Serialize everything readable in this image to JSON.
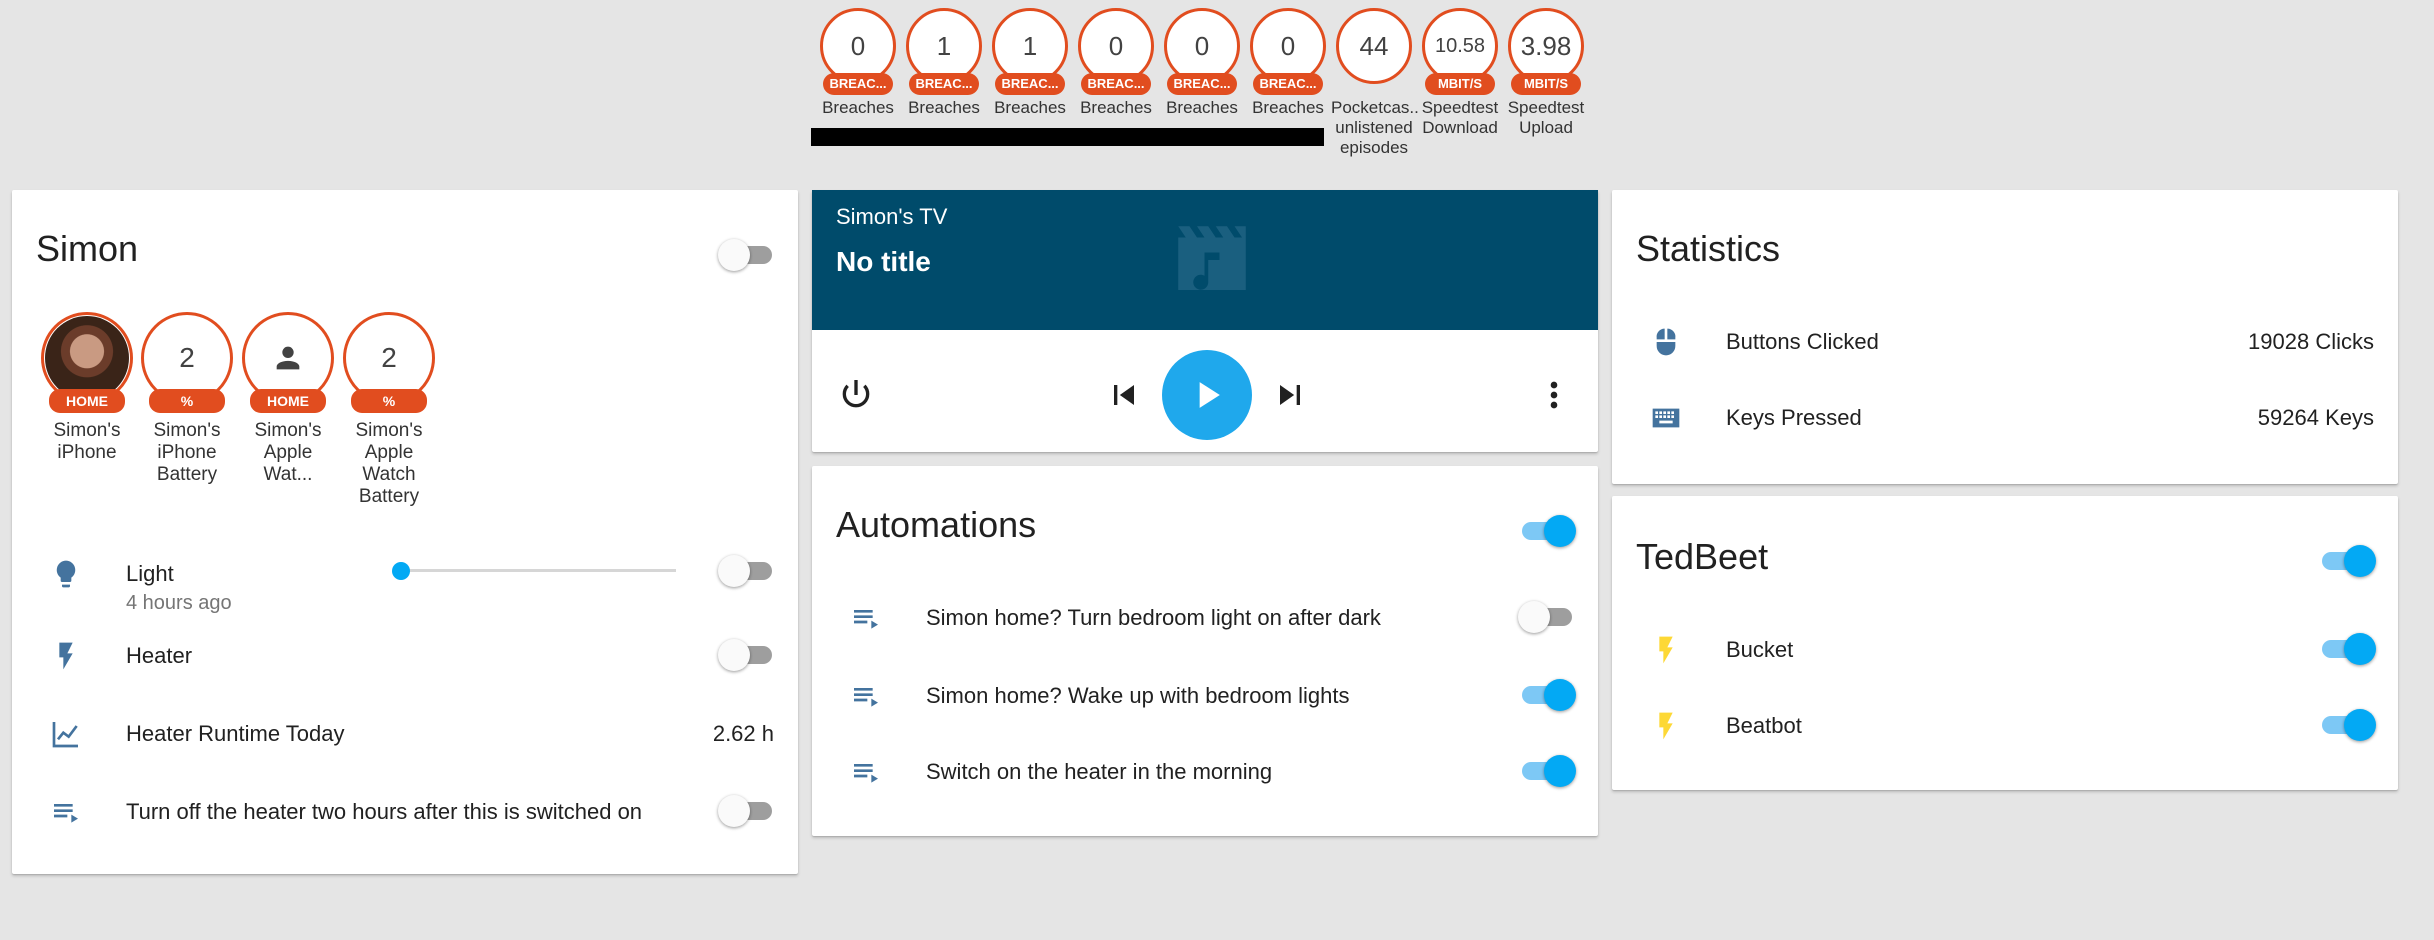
{
  "badges": [
    {
      "value": "0",
      "unit": "BREAC...",
      "label": "Breaches"
    },
    {
      "value": "1",
      "unit": "BREAC...",
      "label": "Breaches"
    },
    {
      "value": "1",
      "unit": "BREAC...",
      "label": "Breaches"
    },
    {
      "value": "0",
      "unit": "BREAC...",
      "label": "Breaches"
    },
    {
      "value": "0",
      "unit": "BREAC...",
      "label": "Breaches"
    },
    {
      "value": "0",
      "unit": "BREAC...",
      "label": "Breaches"
    },
    {
      "value": "44",
      "unit": "",
      "label": "Pocketcas.. unlistened episodes"
    },
    {
      "value": "10.58",
      "unit": "MBIT/S",
      "label": "Speedtest Download"
    },
    {
      "value": "3.98",
      "unit": "MBIT/S",
      "label": "Speedtest Upload"
    }
  ],
  "simon": {
    "title": "Simon",
    "toggle_on": false,
    "people": [
      {
        "value": "",
        "unit": "HOME",
        "label": "Simon's iPhone",
        "icon": "avatar-photo"
      },
      {
        "value": "2",
        "unit": "%",
        "label": "Simon's iPhone Battery"
      },
      {
        "value": "",
        "unit": "HOME",
        "label": "Simon's Apple Wat...",
        "icon": "person-icon"
      },
      {
        "value": "2",
        "unit": "%",
        "label": "Simon's Apple Watch Battery"
      }
    ],
    "rows": [
      {
        "icon": "lightbulb-icon",
        "label": "Light",
        "sub": "4 hours ago",
        "slider": 0.0,
        "toggle_on": false
      },
      {
        "icon": "flash-icon",
        "label": "Heater",
        "toggle_on": false
      },
      {
        "icon": "chart-line-icon",
        "label": "Heater Runtime Today",
        "value": "2.62 h"
      },
      {
        "icon": "playlist-play-icon",
        "label": "Turn off the heater two hours after this is switched on",
        "toggle_on": false
      }
    ]
  },
  "media": {
    "name": "Simon's TV",
    "title": "No title",
    "art_icon": "movie-music-icon",
    "controls": [
      "power-icon",
      "skip-previous-icon",
      "play-icon",
      "skip-next-icon",
      "more-vertical-icon"
    ]
  },
  "automations": {
    "title": "Automations",
    "toggle_on": true,
    "rows": [
      {
        "icon": "playlist-play-icon",
        "label": "Simon home? Turn bedroom light on after dark",
        "toggle_on": false
      },
      {
        "icon": "playlist-play-icon",
        "label": "Simon home? Wake up with bedroom lights",
        "toggle_on": true
      },
      {
        "icon": "playlist-play-icon",
        "label": "Switch on the heater in the morning",
        "toggle_on": true
      }
    ]
  },
  "statistics": {
    "title": "Statistics",
    "rows": [
      {
        "icon": "mouse-icon",
        "label": "Buttons Clicked",
        "value": "19028 Clicks"
      },
      {
        "icon": "keyboard-icon",
        "label": "Keys Pressed",
        "value": "59264 Keys"
      }
    ]
  },
  "tedbeet": {
    "title": "TedBeet",
    "toggle_on": true,
    "rows": [
      {
        "icon": "flash-icon",
        "label": "Bucket",
        "toggle_on": true
      },
      {
        "icon": "flash-icon",
        "label": "Beatbot",
        "toggle_on": true
      }
    ]
  },
  "colors": {
    "badge_accent": "#e14d1f",
    "icon_blue": "#44739e",
    "toggle_on": "#03a9f4",
    "flash_on": "#fdd835",
    "media_bg": "#004b6b"
  }
}
